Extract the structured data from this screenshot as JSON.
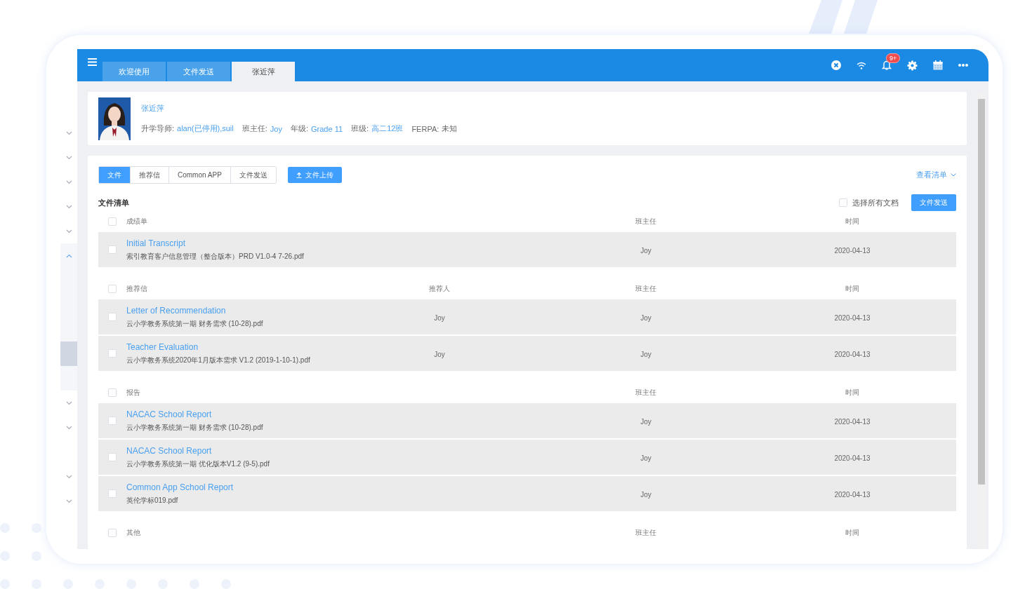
{
  "sidebar": {
    "items": [
      {
        "kind": "chevron",
        "expanded": false
      },
      {
        "kind": "chevron",
        "expanded": false
      },
      {
        "kind": "chevron",
        "expanded": false
      },
      {
        "kind": "chevron",
        "expanded": false
      },
      {
        "kind": "chevron",
        "expanded": false
      },
      {
        "kind": "chevron",
        "expanded": true,
        "children": [
          {
            "selected": false
          },
          {
            "selected": false
          },
          {
            "selected": false
          },
          {
            "selected": true
          },
          {
            "selected": false
          }
        ]
      },
      {
        "kind": "chevron",
        "expanded": false
      },
      {
        "kind": "chevron",
        "expanded": false
      },
      {
        "kind": "blank"
      },
      {
        "kind": "chevron",
        "expanded": false
      },
      {
        "kind": "chevron",
        "expanded": false
      }
    ]
  },
  "header": {
    "tabs": [
      {
        "label": "欢迎使用",
        "selected": false
      },
      {
        "label": "文件发送",
        "selected": false
      },
      {
        "label": "张近萍",
        "selected": true
      }
    ],
    "notification_badge": "9+"
  },
  "profile": {
    "name": "张近萍",
    "fields": [
      {
        "label": "升学导师:",
        "value": "alan(已停用),suil",
        "kind": "link"
      },
      {
        "label": "班主任:",
        "value": "Joy",
        "kind": "link"
      },
      {
        "label": "年级:",
        "value": "Grade 11",
        "kind": "link"
      },
      {
        "label": "班级:",
        "value": "高二12班",
        "kind": "link"
      },
      {
        "label": "FERPA:",
        "value": "未知",
        "kind": "plain"
      }
    ]
  },
  "documents": {
    "tabs": [
      {
        "label": "文件",
        "selected": true
      },
      {
        "label": "推荐信",
        "selected": false
      },
      {
        "label": "Common APP",
        "selected": false
      },
      {
        "label": "文件发送",
        "selected": false
      }
    ],
    "upload_button": "文件上传",
    "view_list_link": "查看清单",
    "list_title": "文件清单",
    "select_all": {
      "label": "选择所有文档",
      "checked": false
    },
    "send_button": "文件发送",
    "sections": [
      {
        "title": "成绩单",
        "checked": false,
        "teacher_header": "班主任",
        "time_header": "时间",
        "rows": [
          {
            "title": "Initial Transcript",
            "file": "索引教育客户信息管理（整合版本）PRD V1.0-4 7-26.pdf",
            "teacher": "Joy",
            "date": "2020-04-13",
            "checked": false
          }
        ]
      },
      {
        "title": "推荐信",
        "checked": false,
        "recommender_header": "推荐人",
        "teacher_header": "班主任",
        "time_header": "时间",
        "rows": [
          {
            "title": "Letter of Recommendation",
            "file": "云小学教务系统第一期 财务需求 (10-28).pdf",
            "recommender": "Joy",
            "teacher": "Joy",
            "date": "2020-04-13",
            "checked": false
          },
          {
            "title": "Teacher Evaluation",
            "file": "云小学教务系统2020年1月版本需求 V1.2 (2019-1-10-1).pdf",
            "recommender": "Joy",
            "teacher": "Joy",
            "date": "2020-04-13",
            "checked": false
          }
        ]
      },
      {
        "title": "报告",
        "checked": false,
        "teacher_header": "班主任",
        "time_header": "时间",
        "rows": [
          {
            "title": "NACAC School Report",
            "file": "云小学教务系统第一期 财务需求 (10-28).pdf",
            "teacher": "Joy",
            "date": "2020-04-13",
            "checked": false
          },
          {
            "title": "NACAC School Report",
            "file": "云小学教务系统第一期 优化版本V1.2 (9-5).pdf",
            "teacher": "Joy",
            "date": "2020-04-13",
            "checked": false
          },
          {
            "title": "Common App School Report",
            "file": "英伦学标019.pdf",
            "teacher": "Joy",
            "date": "2020-04-13",
            "checked": false
          }
        ]
      },
      {
        "title": "其他",
        "checked": false,
        "teacher_header": "班主任",
        "time_header": "时间"
      }
    ]
  }
}
